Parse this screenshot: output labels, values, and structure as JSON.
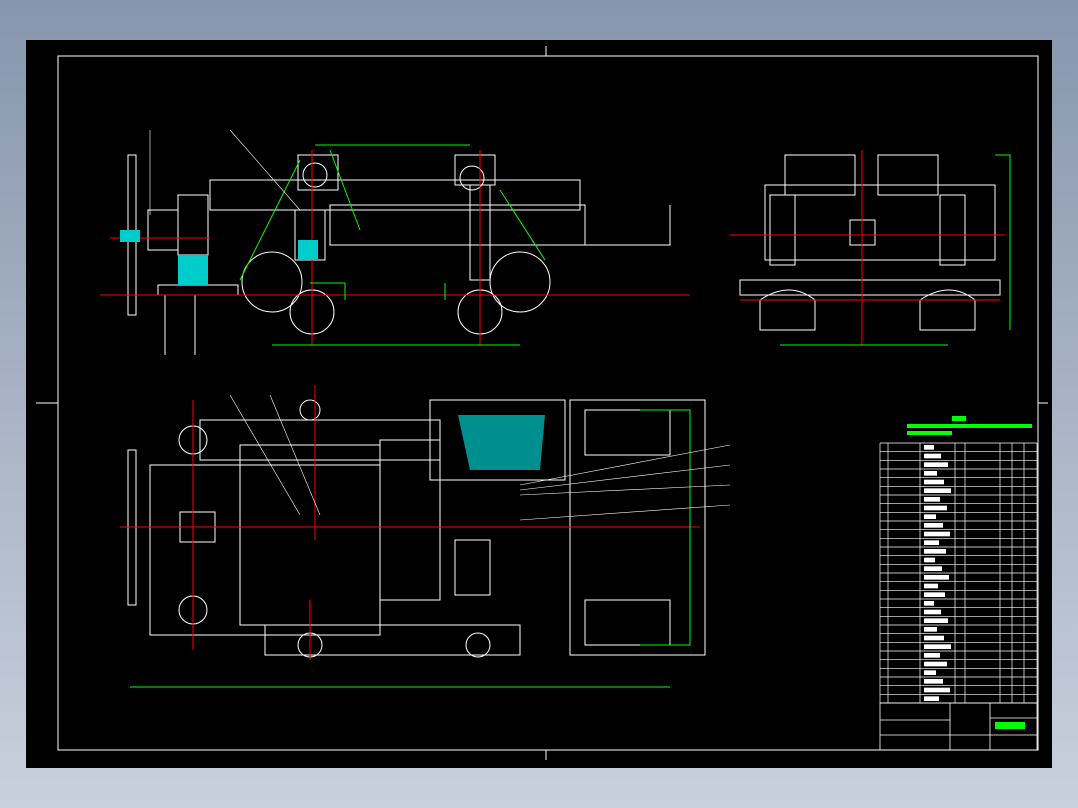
{
  "colors": {
    "background": "#000000",
    "outline": "#ffffff",
    "centerline": "#ff0000",
    "dimension": "#00ff00",
    "hatch": "#00cccc",
    "parts": "#ff00ff"
  },
  "bom": {
    "rows": 30,
    "columns": 8
  }
}
